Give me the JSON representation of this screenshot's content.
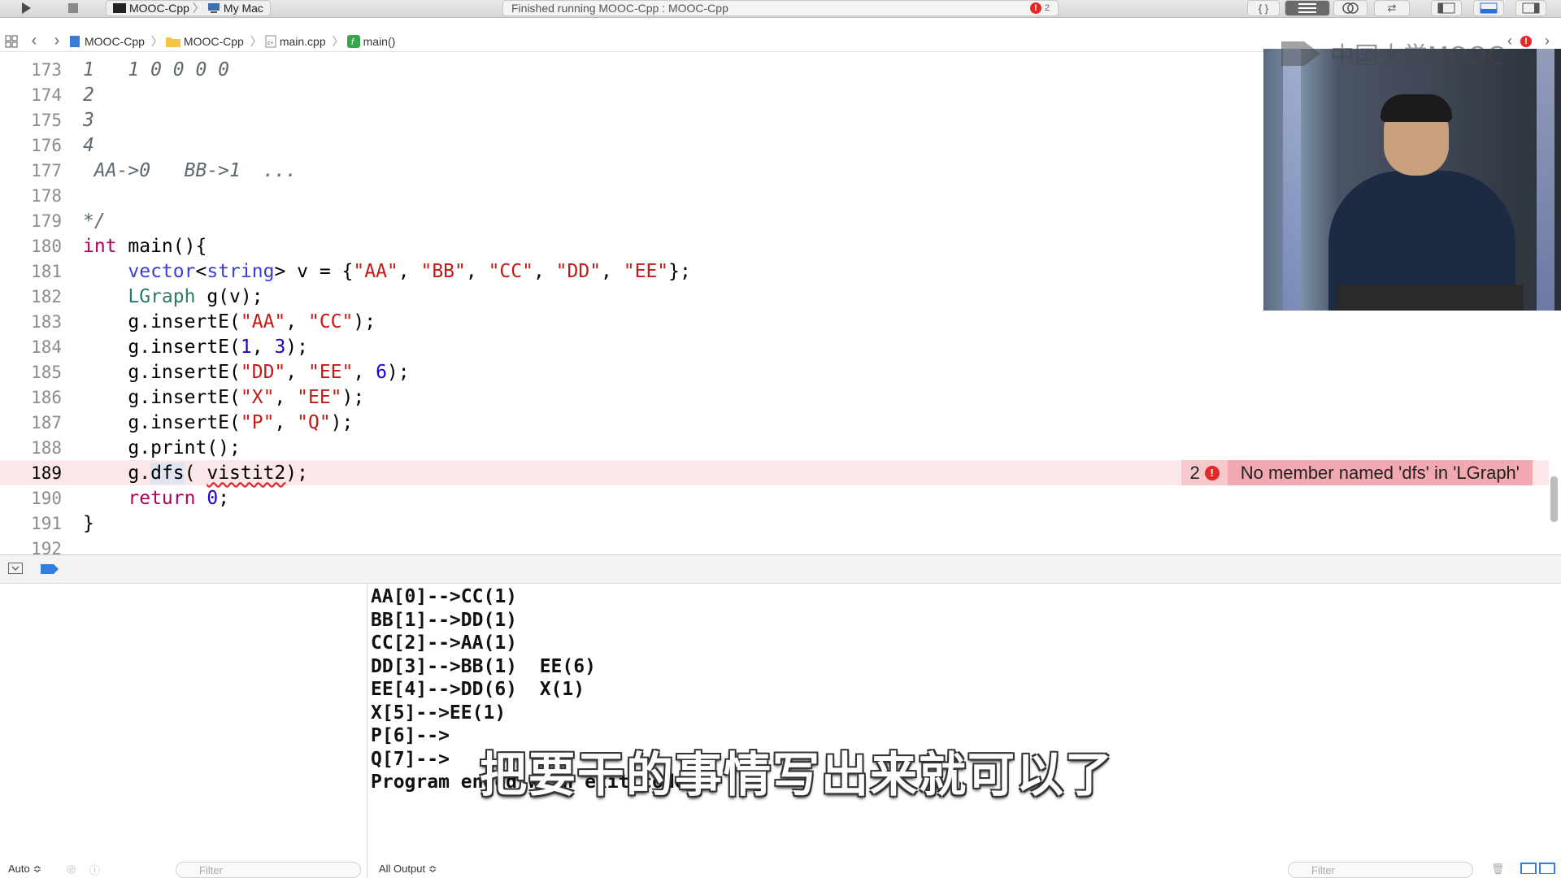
{
  "toolbar": {
    "scheme_project": "MOOC-Cpp",
    "scheme_device": "My Mac",
    "activity_status": "Finished running MOOC-Cpp : MOOC-Cpp",
    "activity_error_count": "2"
  },
  "jumpbar": {
    "crumbs": [
      "MOOC-Cpp",
      "MOOC-Cpp",
      "main.cpp",
      "main()"
    ]
  },
  "editor": {
    "lines": [
      {
        "num": "173",
        "text": "1   1 0 0 0 0"
      },
      {
        "num": "174",
        "text": "2"
      },
      {
        "num": "175",
        "text": "3"
      },
      {
        "num": "176",
        "text": "4"
      },
      {
        "num": "177",
        "text": " AA->0   BB->1  ..."
      },
      {
        "num": "178",
        "text": ""
      },
      {
        "num": "179",
        "text": "*/"
      },
      {
        "num": "180",
        "text": "int main(){"
      },
      {
        "num": "181",
        "text": "    vector<string> v = {\"AA\", \"BB\", \"CC\", \"DD\", \"EE\"};"
      },
      {
        "num": "182",
        "text": "    LGraph g(v);"
      },
      {
        "num": "183",
        "text": "    g.insertE(\"AA\", \"CC\");"
      },
      {
        "num": "184",
        "text": "    g.insertE(1, 3);"
      },
      {
        "num": "185",
        "text": "    g.insertE(\"DD\", \"EE\", 6);"
      },
      {
        "num": "186",
        "text": "    g.insertE(\"X\", \"EE\");"
      },
      {
        "num": "187",
        "text": "    g.insertE(\"P\", \"Q\");"
      },
      {
        "num": "188",
        "text": "    g.print();"
      },
      {
        "num": "189",
        "text": "    g.dfs( vistit2);"
      },
      {
        "num": "190",
        "text": "    return 0;"
      },
      {
        "num": "191",
        "text": "}"
      },
      {
        "num": "192",
        "text": ""
      }
    ],
    "error_annotation": {
      "line": "189",
      "count": "2",
      "message": "No member named 'dfs' in 'LGraph'"
    }
  },
  "console": {
    "output": [
      "AA[0]-->CC(1)",
      "BB[1]-->DD(1)",
      "CC[2]-->AA(1)",
      "DD[3]-->BB(1)  EE(6)",
      "EE[4]-->DD(6)  X(1)",
      "X[5]-->EE(1)",
      "P[6]-->",
      "Q[7]-->",
      "Program ended with exit code: 0"
    ],
    "vars_scope": "Auto ≎",
    "output_scope": "All Output ≎",
    "filter_placeholder": "Filter"
  },
  "overlay": {
    "watermark": "中国大学MOOC",
    "subtitle": "把要干的事情写出来就可以了"
  },
  "colors": {
    "keyword": "#b2005f",
    "string": "#c41a16",
    "number": "#1c00cf",
    "type": "#3b3dd4",
    "error_line_bg": "#fbe6e8",
    "error_badge": "#e02a2a"
  }
}
